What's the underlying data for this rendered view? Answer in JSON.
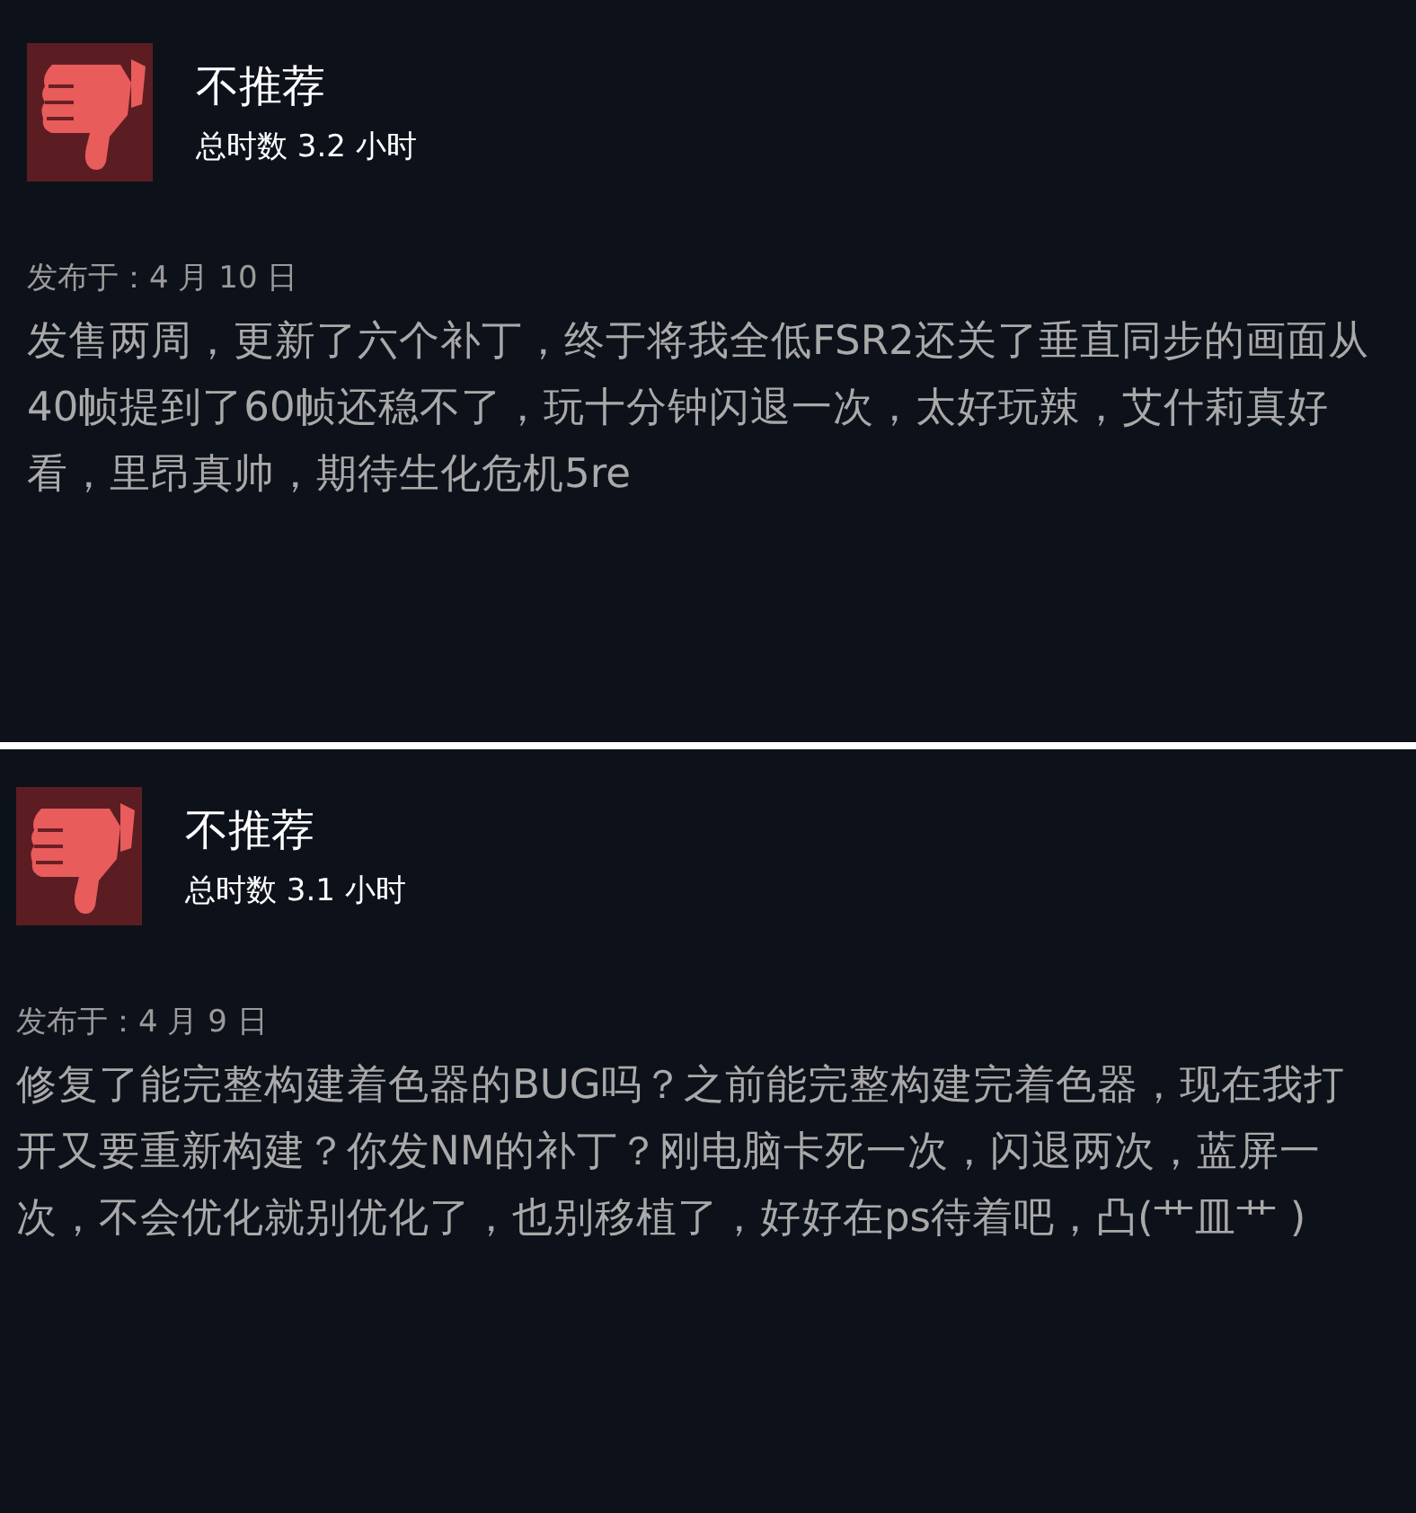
{
  "reviews": [
    {
      "recommended": false,
      "verdict": "不推荐",
      "hours": "总时数 3.2 小时",
      "posted": "发布于：4 月 10 日",
      "text": "发售两周，更新了六个补丁，终于将我全低FSR2还关了垂直同步的画面从40帧提到了60帧还稳不了，玩十分钟闪退一次，太好玩辣，艾什莉真好看，里昂真帅，期待生化危机5re"
    },
    {
      "recommended": false,
      "verdict": "不推荐",
      "hours": "总时数 3.1 小时",
      "posted": "发布于：4 月 9 日",
      "text": "修复了能完整构建着色器的BUG吗？之前能完整构建完着色器，现在我打开又要重新构建？你发NM的补丁？刚电脑卡死一次，闪退两次，蓝屏一次，不会优化就别优化了，也别移植了，好好在ps待着吧，凸(艹皿艹 )"
    }
  ]
}
